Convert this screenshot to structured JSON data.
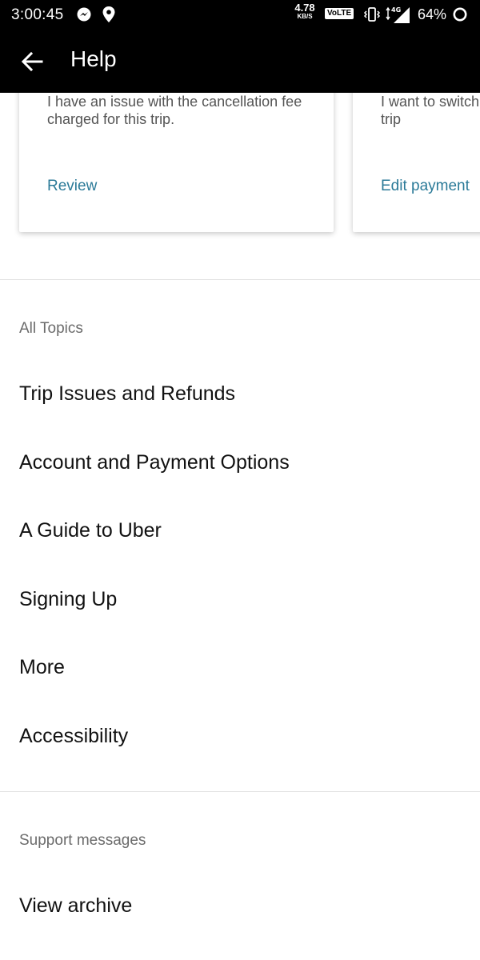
{
  "status_bar": {
    "time": "3:00:45",
    "speed_value": "4.78",
    "speed_unit": "KB/S",
    "volte": "VoLTE",
    "network": "4G",
    "battery": "64%"
  },
  "toolbar": {
    "title": "Help"
  },
  "cards": [
    {
      "text": "I have an issue with the cancellation fee charged for this trip.",
      "action": "Review"
    },
    {
      "text": "I want to switch payment method for this trip",
      "action": "Edit payment"
    }
  ],
  "all_topics": {
    "header": "All Topics",
    "items": [
      "Trip Issues and Refunds",
      "Account and Payment Options",
      "A Guide to Uber",
      "Signing Up",
      "More",
      "Accessibility"
    ]
  },
  "support_messages": {
    "header": "Support messages",
    "items": [
      "View archive"
    ]
  },
  "colors": {
    "bar_background": "#000000",
    "link": "#2b7a98",
    "divider": "#e2e2e2"
  }
}
